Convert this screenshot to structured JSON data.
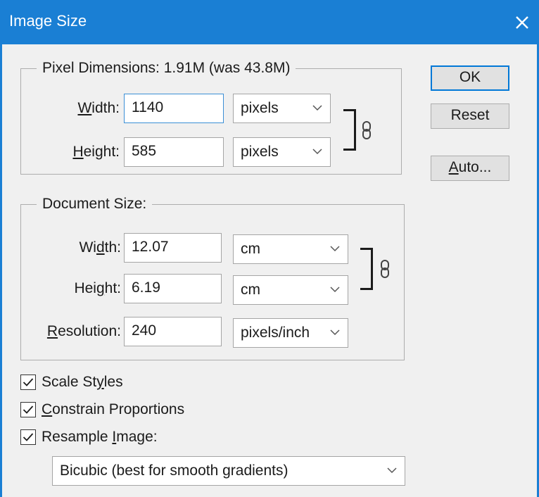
{
  "window": {
    "title": "Image Size",
    "close_icon": "close-icon"
  },
  "pixel_dimensions": {
    "legend": "Pixel Dimensions:  1.91M (was 43.8M)",
    "width_label_prefix": "",
    "width_label_mnemonic": "W",
    "width_label_rest": "idth:",
    "width_value": "1140",
    "width_unit": "pixels",
    "height_label_mnemonic": "H",
    "height_label_rest": "eight:",
    "height_value": "585",
    "height_unit": "pixels",
    "link_icon": "chain-link-icon"
  },
  "document_size": {
    "legend": "Document Size:",
    "width_label_prefix": "Wi",
    "width_label_mnemonic": "d",
    "width_label_rest": "th:",
    "width_value": "12.07",
    "width_unit": "cm",
    "height_label_prefix": "Hei",
    "height_label_mnemonic": "g",
    "height_label_rest": "ht:",
    "height_value": "6.19",
    "height_unit": "cm",
    "resolution_label_mnemonic": "R",
    "resolution_label_rest": "esolution:",
    "resolution_value": "240",
    "resolution_unit": "pixels/inch",
    "link_icon": "chain-link-icon"
  },
  "buttons": {
    "ok": "OK",
    "reset": "Reset",
    "auto_mnemonic": "A",
    "auto_rest": "uto..."
  },
  "options": {
    "scale_styles_prefix": "Scale St",
    "scale_styles_mnemonic": "y",
    "scale_styles_rest": "les",
    "scale_styles_checked": true,
    "constrain_mnemonic": "C",
    "constrain_rest": "onstrain Proportions",
    "constrain_checked": true,
    "resample_prefix": "Resample ",
    "resample_mnemonic": "I",
    "resample_rest": "mage:",
    "resample_checked": true,
    "resample_method": "Bicubic (best for smooth gradients)"
  }
}
